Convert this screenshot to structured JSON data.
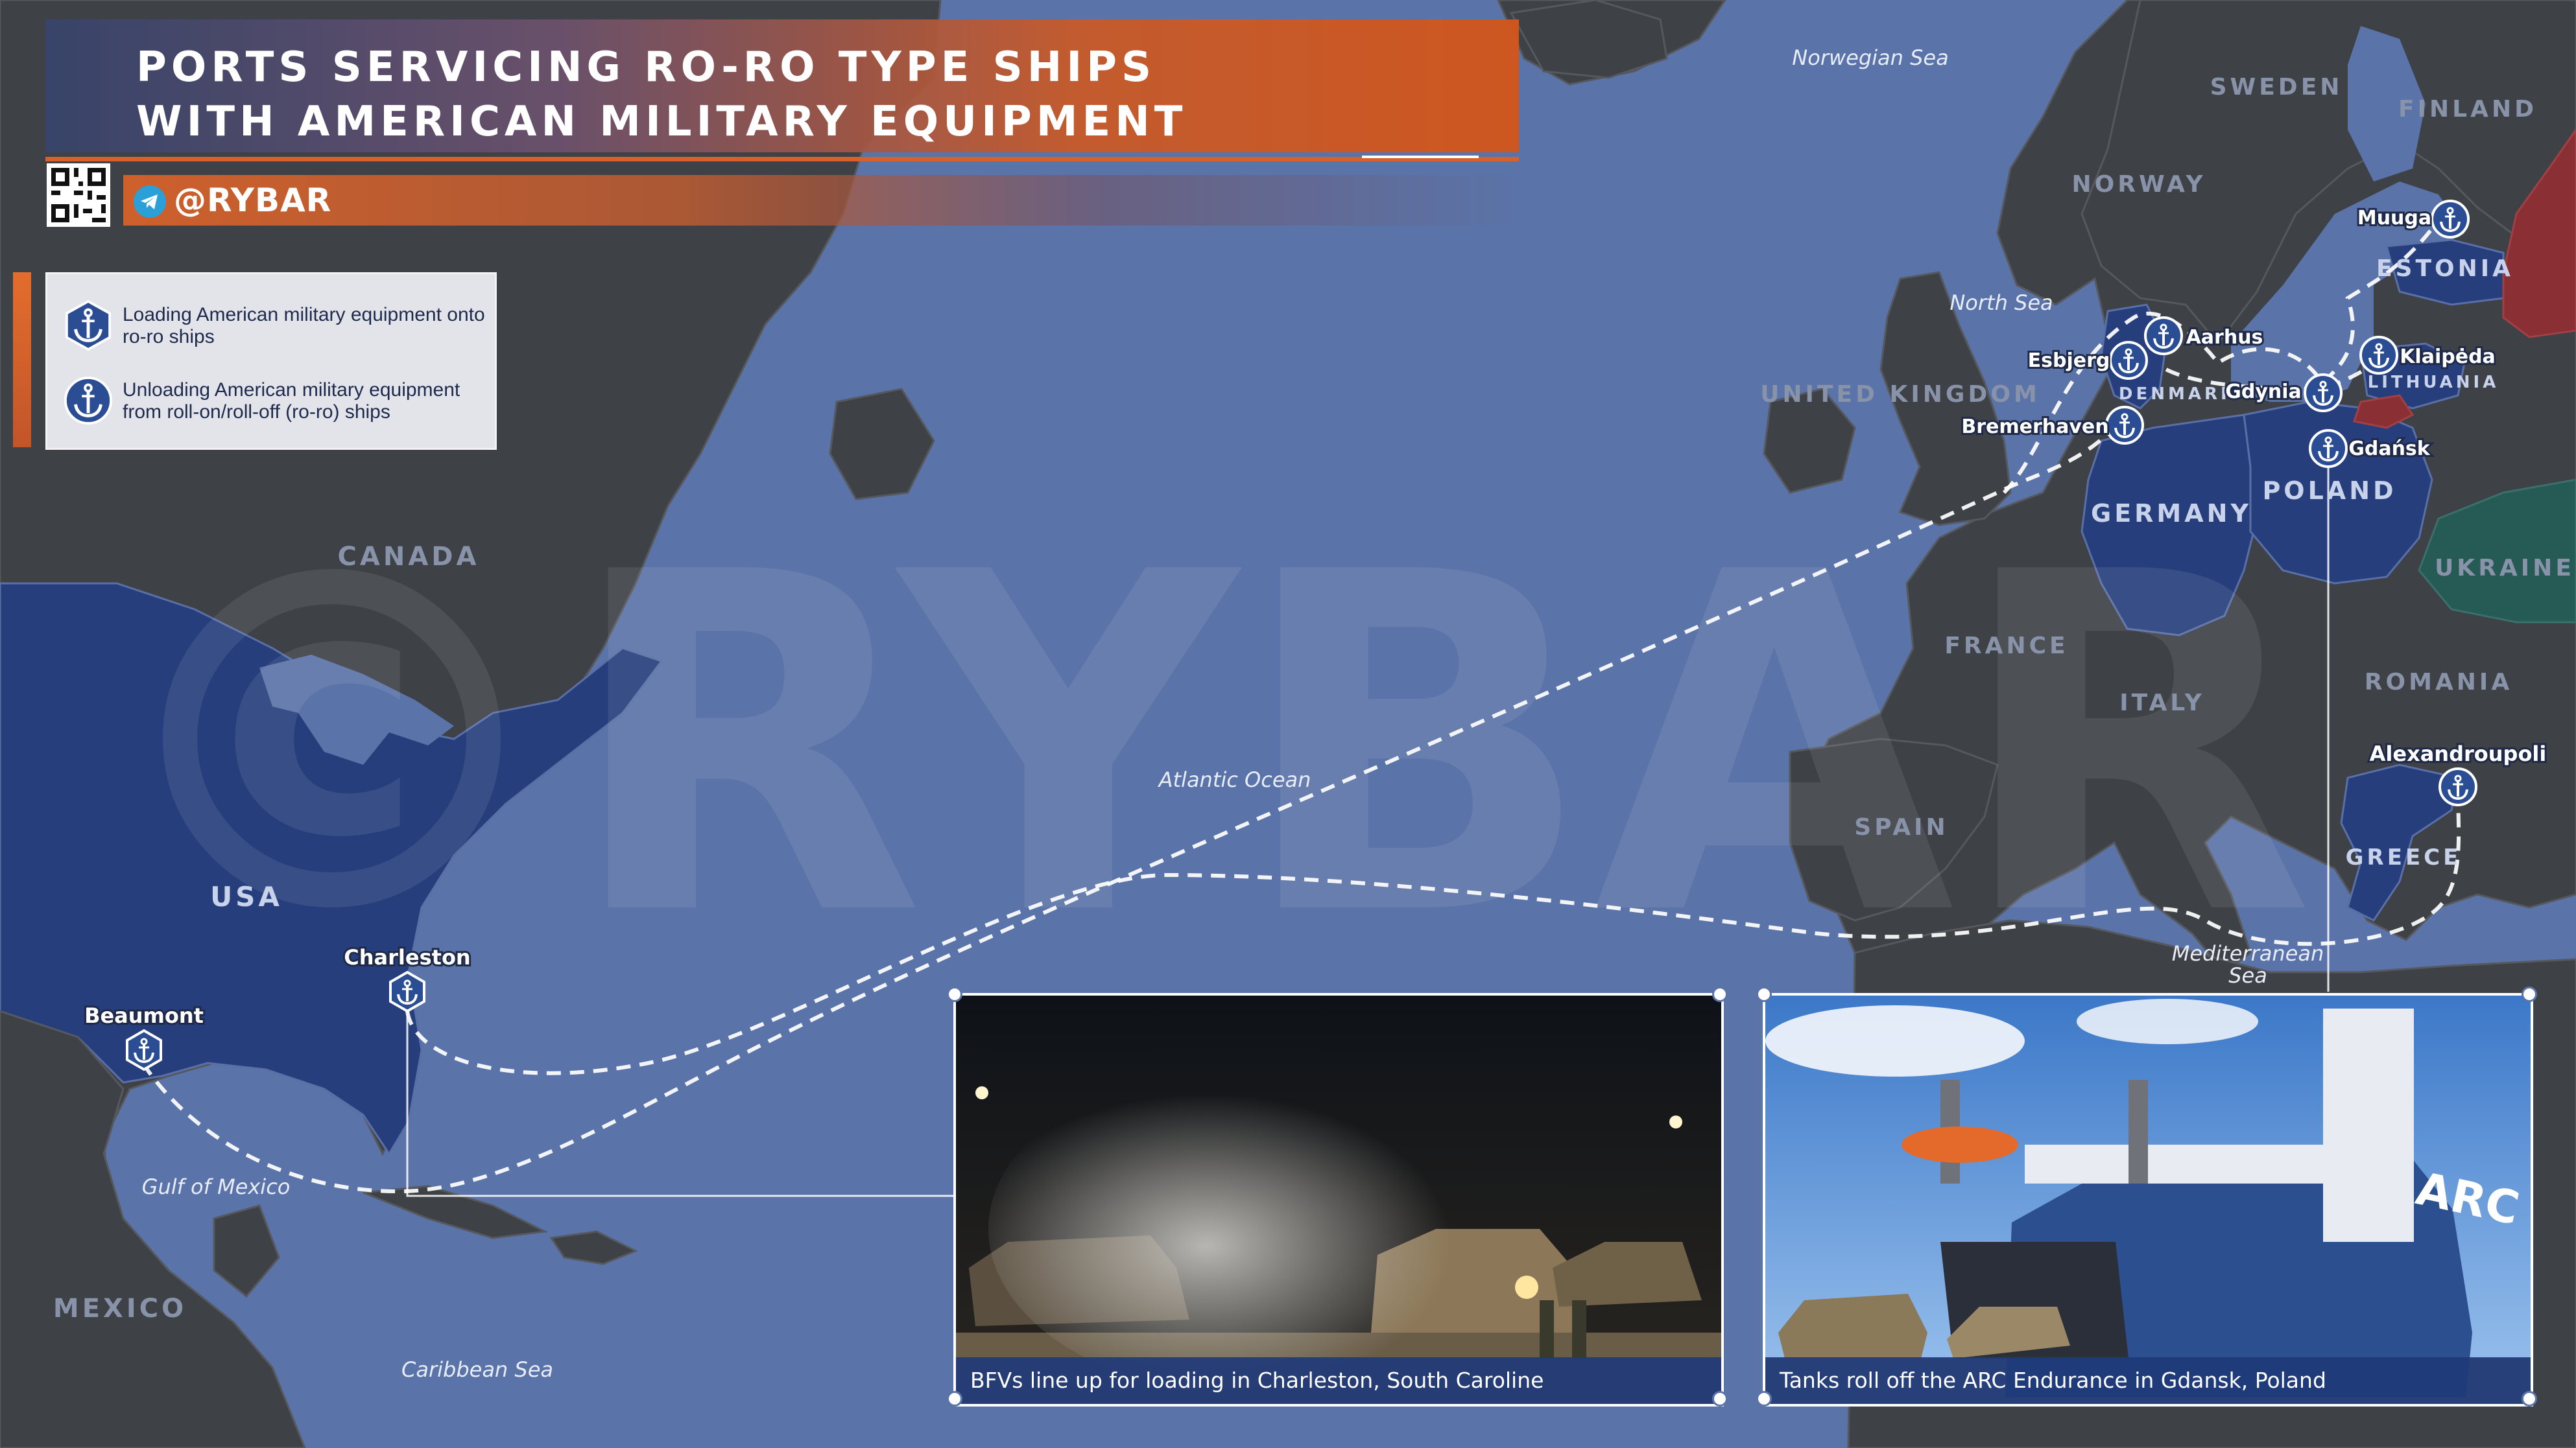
{
  "title": {
    "line1": "PORTS SERVICING RO-RO TYPE SHIPS",
    "line2": "WITH AMERICAN MILITARY EQUIPMENT"
  },
  "brand": {
    "handle": "@RYBAR",
    "watermark": "©RYBAR"
  },
  "legend": [
    {
      "icon": "anchor-icon",
      "text": "Loading American military equipment onto ro-ro ships"
    },
    {
      "icon": "anchor-icon",
      "text": "Unloading American military equipment from roll-on/roll-off (ro-ro) ships"
    }
  ],
  "countries": {
    "canada": "CANADA",
    "usa": "USA",
    "mexico": "MEXICO",
    "sweden": "SWEDEN",
    "finland": "FINLAND",
    "norway": "NORWAY",
    "estonia": "ESTONIA",
    "uk": "UNITED KINGDOM",
    "denmark": "DENMARK",
    "lithuania": "LITHUANIA",
    "germany": "GERMANY",
    "poland": "POLAND",
    "ukraine": "UKRAINE",
    "france": "FRANCE",
    "romania": "ROMANIA",
    "italy": "ITALY",
    "spain": "SPAIN",
    "greece": "GREECE"
  },
  "seas": {
    "norwegian": "Norwegian Sea",
    "north": "North Sea",
    "atlantic": "Atlantic Ocean",
    "gulf_mexico": "Gulf of Mexico",
    "caribbean": "Caribbean Sea",
    "mediterranean_1": "Mediterranean",
    "mediterranean_2": "Sea"
  },
  "ports": {
    "beaumont": "Beaumont",
    "charleston": "Charleston",
    "muuga": "Muuga",
    "aarhus": "Aarhus",
    "esbjerg": "Esbjerg",
    "klaipeda": "Klaipėda",
    "gdynia": "Gdynia",
    "bremerhaven": "Bremerhaven",
    "gdansk": "Gdańsk",
    "alexandroupoli": "Alexandroupoli"
  },
  "photos": [
    {
      "caption": "BFVs line up for loading in Charleston, South Caroline"
    },
    {
      "caption": "Tanks roll off the ARC Endurance in Gdansk, Poland",
      "ship_text": "ARC"
    }
  ],
  "colors": {
    "sea": "#5a73a8",
    "land": "#3e4145",
    "highlight_country": "#263f7c",
    "russia": "#8a2f33",
    "ukraine": "#255a55",
    "accent_orange": "#d8602a",
    "caption_bg": "#203a78"
  }
}
